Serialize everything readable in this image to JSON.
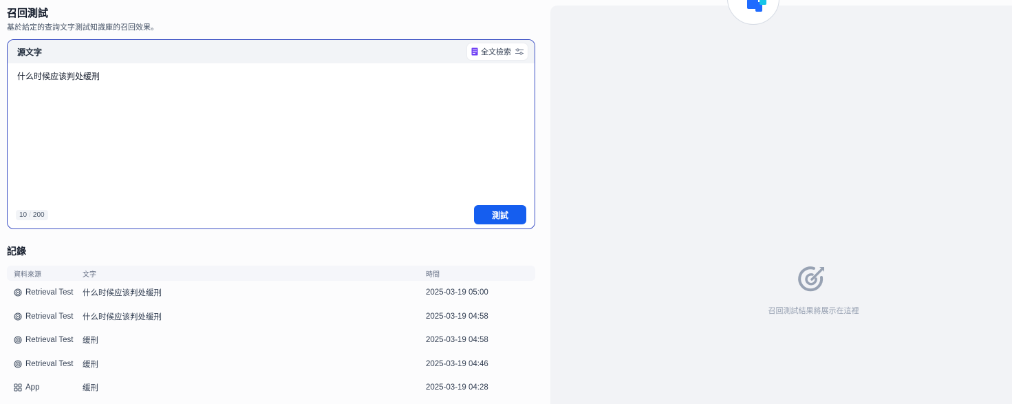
{
  "header": {
    "title": "召回測試",
    "description": "基於給定的查詢文字測試知識庫的召回效果。"
  },
  "query": {
    "section_label": "源文字",
    "mode_label": "全文檢索",
    "text": "什么时候应该判处缓刑",
    "count": "10",
    "max": "200",
    "submit_label": "測試"
  },
  "records": {
    "title": "記錄",
    "columns": [
      "資料來源",
      "文字",
      "時間"
    ],
    "rows": [
      {
        "source": "Retrieval Test",
        "source_icon": "target-icon",
        "text": "什么时候应该判处缓刑",
        "time": "2025-03-19 05:00"
      },
      {
        "source": "Retrieval Test",
        "source_icon": "target-icon",
        "text": "什么时候应该判处缓刑",
        "time": "2025-03-19 04:58"
      },
      {
        "source": "Retrieval Test",
        "source_icon": "target-icon",
        "text": "缓刑",
        "time": "2025-03-19 04:58"
      },
      {
        "source": "Retrieval Test",
        "source_icon": "target-icon",
        "text": "缓刑",
        "time": "2025-03-19 04:46"
      },
      {
        "source": "App",
        "source_icon": "app-grid-icon",
        "text": "缓刑",
        "time": "2025-03-19 04:28"
      }
    ]
  },
  "result_panel": {
    "empty_text": "召回測試結果將展示在這裡",
    "empty_icon": "retrieval-target-icon"
  },
  "colors": {
    "accent": "#155eef",
    "query_border": "#3b4fc4",
    "panel_bg": "#f2f3f6",
    "logo_blue": "#1f6bff",
    "logo_cyan": "#17c5e8"
  }
}
